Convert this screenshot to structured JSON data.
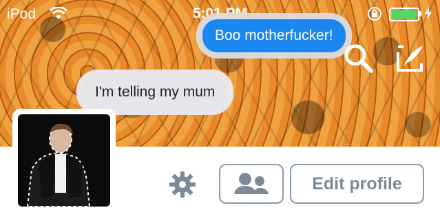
{
  "status_bar": {
    "carrier": "iPod",
    "time": "5:01 PM",
    "battery_level": 1.0,
    "colors": {
      "battery": "#4cd964"
    }
  },
  "messages": [
    {
      "type": "sent",
      "text": "Boo motherfucker!"
    },
    {
      "type": "received",
      "text": "I'm telling my mum"
    }
  ],
  "header": {
    "icons": [
      "search-icon",
      "compose-icon"
    ]
  },
  "profile": {
    "edit_label": "Edit profile",
    "icons": [
      "gear-icon",
      "people-icon"
    ]
  },
  "colors": {
    "sent_bubble": "#1a86f0",
    "received_bubble": "#e5e5ea",
    "button_border": "#8a9aa8",
    "button_text": "#7b8a97"
  }
}
